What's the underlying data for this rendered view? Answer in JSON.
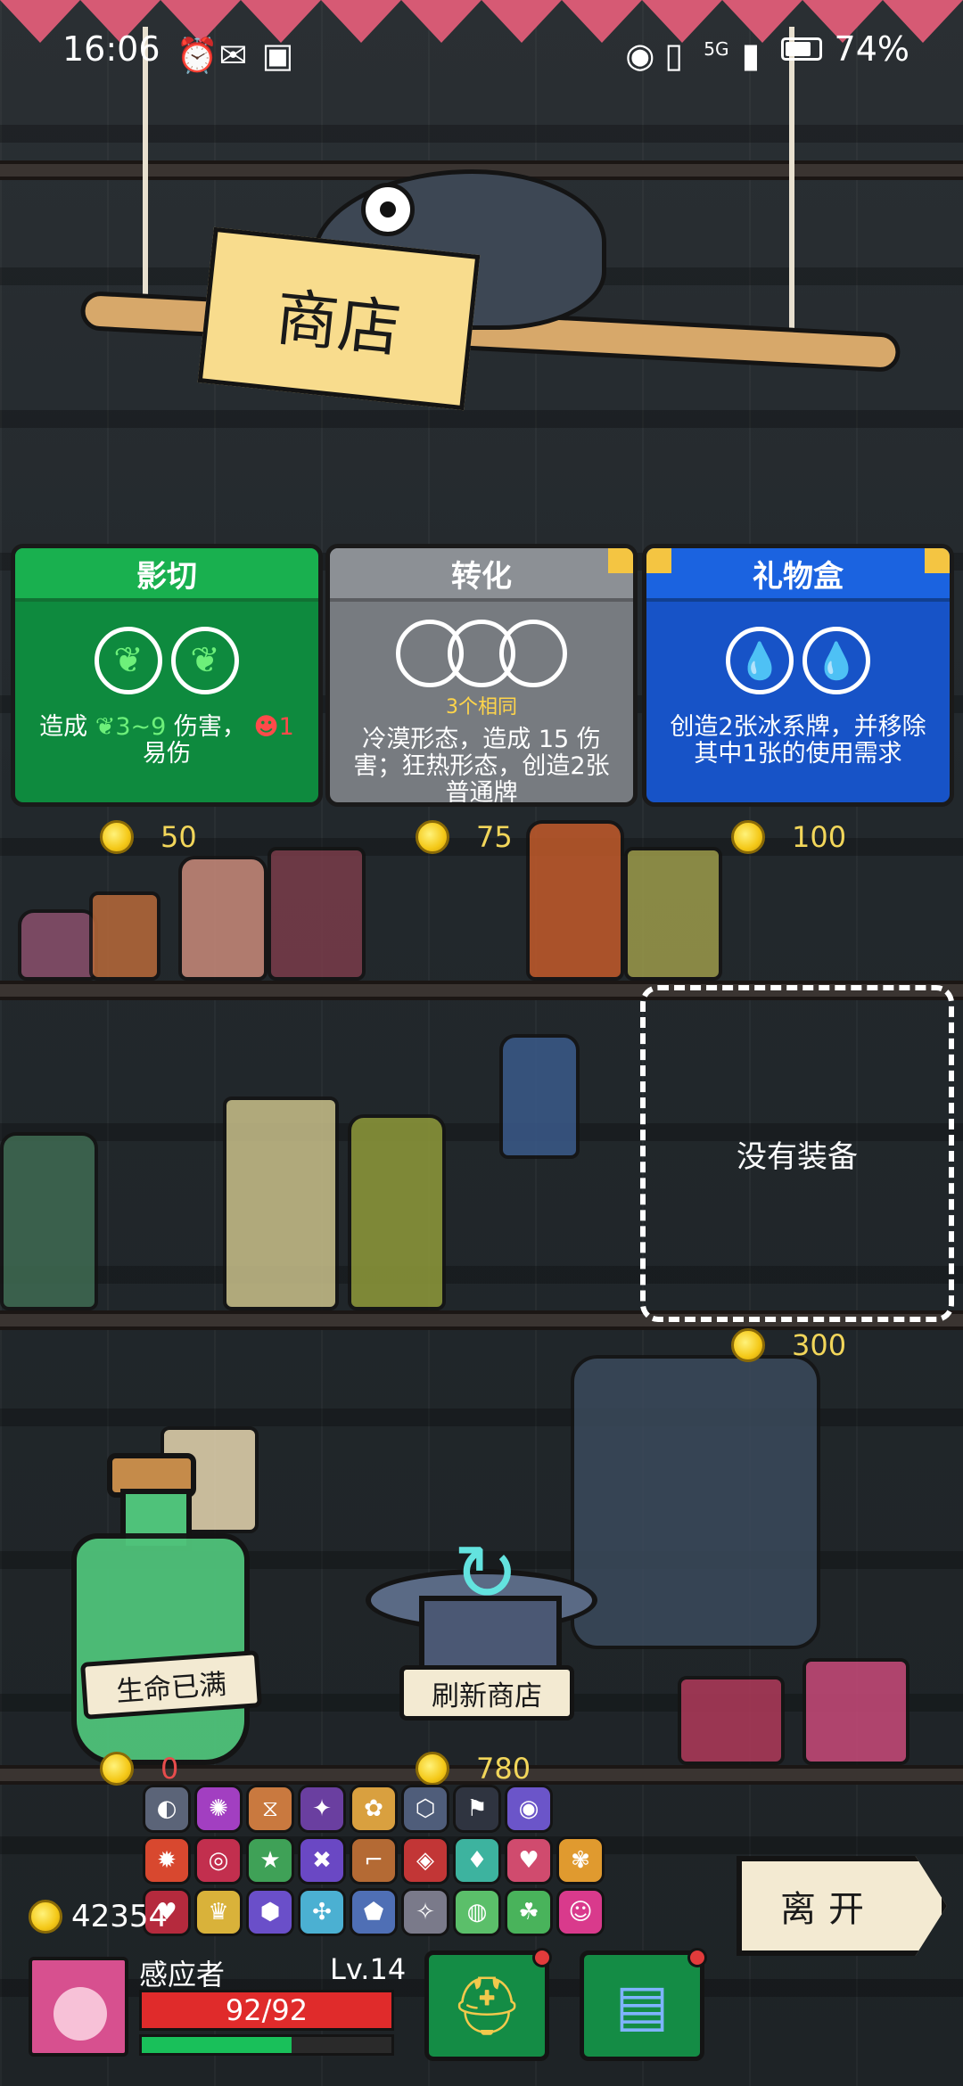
{
  "status_bar": {
    "time": "16:06",
    "network": "5G",
    "battery": "74%"
  },
  "shop_sign": "商店",
  "cards": [
    {
      "title": "影切",
      "description_prefix": "造成",
      "damage_range": "3~9",
      "description_mid": "伤害，",
      "vulnerable_value": "1",
      "description_suffix": "易伤",
      "price": "50",
      "color": "#0e8a3e"
    },
    {
      "title": "转化",
      "subtitle": "3个相同",
      "description": "冷漠形态，造成 15 伤害；狂热形态，创造2张普通牌",
      "price": "75",
      "color": "#777b80"
    },
    {
      "title": "礼物盒",
      "description": "创造2张冰系牌，并移除其中1张的使用需求",
      "price": "100",
      "color": "#1753c7"
    }
  ],
  "equipment": {
    "empty_label": "没有装备",
    "price": "300"
  },
  "heal": {
    "label": "生命已满",
    "price": "0"
  },
  "refresh": {
    "label": "刷新商店",
    "price": "780"
  },
  "leave_label": "离开",
  "gold_total": "42354",
  "player": {
    "name": "感应者",
    "level": "Lv.14",
    "hp": "92/92",
    "xp_fraction": 0.6
  },
  "relics": [
    {
      "icon": "◐",
      "color": "#5b6478"
    },
    {
      "icon": "✺",
      "color": "#a23fc1"
    },
    {
      "icon": "⧖",
      "color": "#c9793f"
    },
    {
      "icon": "✦",
      "color": "#6a3fa0"
    },
    {
      "icon": "✿",
      "color": "#d9a03f"
    },
    {
      "icon": "⬡",
      "color": "#4f5d7a"
    },
    {
      "icon": "⚑",
      "color": "#2f3440"
    },
    {
      "icon": "◉",
      "color": "#6b55c9"
    },
    {
      "icon": "",
      "color": "transparent"
    },
    {
      "icon": "✹",
      "color": "#d8482f"
    },
    {
      "icon": "◎",
      "color": "#c22f4e"
    },
    {
      "icon": "★",
      "color": "#3fa157"
    },
    {
      "icon": "✖",
      "color": "#6a48c4"
    },
    {
      "icon": "⌐",
      "color": "#b46a34"
    },
    {
      "icon": "◈",
      "color": "#c23636"
    },
    {
      "icon": "♦",
      "color": "#3db39f"
    },
    {
      "icon": "♥",
      "color": "#d04b6e"
    },
    {
      "icon": "✾",
      "color": "#e09a2f"
    },
    {
      "icon": "♥",
      "color": "#b52a3d"
    },
    {
      "icon": "♛",
      "color": "#d9b23a"
    },
    {
      "icon": "⬢",
      "color": "#6a4fc9"
    },
    {
      "icon": "✣",
      "color": "#4bb0d2"
    },
    {
      "icon": "⬟",
      "color": "#4f6fb5"
    },
    {
      "icon": "✧",
      "color": "#7a7a8a"
    },
    {
      "icon": "◍",
      "color": "#5bbf6a"
    },
    {
      "icon": "☘",
      "color": "#49b35b"
    },
    {
      "icon": "☺",
      "color": "#d93a8c"
    }
  ]
}
